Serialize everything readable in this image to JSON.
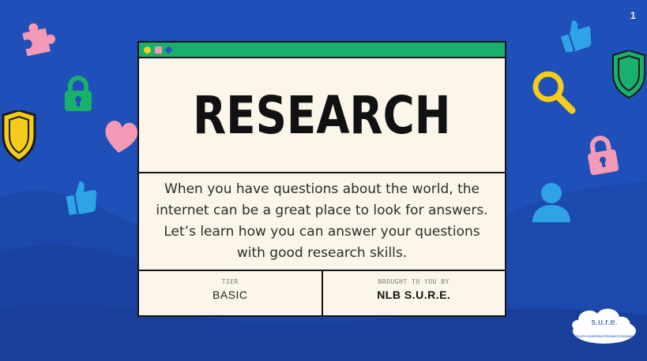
{
  "slide": {
    "page_number": "1",
    "title": "RESEARCH",
    "description": "When you have questions about the world, the internet can be a great place to look for answers. Let’s learn how you can answer your questions with good research skills.",
    "tier_label": "TIER",
    "tier_value": "BASIC",
    "brought_label": "BROUGHT TO YOU BY",
    "brought_value": "NLB S.U.R.E."
  },
  "logo": {
    "text": "s.u.r.e.",
    "tagline": "Source·Understand·Research·Evaluate"
  },
  "colors": {
    "background": "#1f4fb8",
    "window_bg": "#fbf6e9",
    "titlebar": "#18b06c",
    "yellow": "#f5cc1b",
    "pink": "#f49ab6",
    "green": "#19b06c",
    "light_blue": "#2ea3e6"
  },
  "decor_icons": [
    "puzzle-icon",
    "lock-icon",
    "shield-icon",
    "heart-icon",
    "thumbs-up-icon",
    "magnifier-icon",
    "user-icon"
  ]
}
